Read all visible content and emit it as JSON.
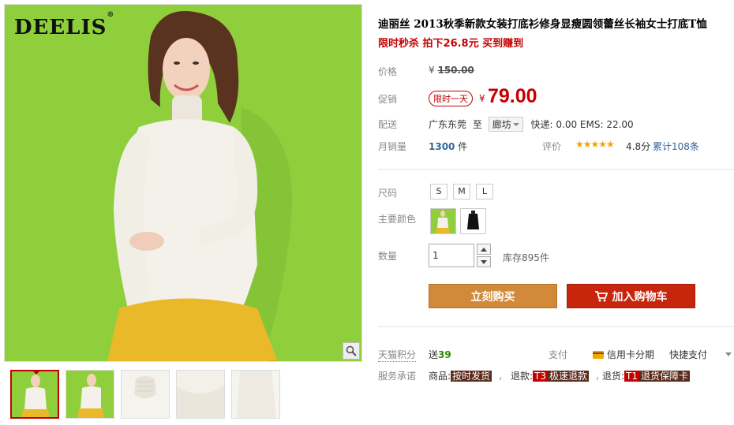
{
  "gallery": {
    "brand": "DEELIS",
    "brand_mark": "®",
    "colors": {
      "background": "#8fcf3c",
      "skirt": "#e9b92a",
      "shirt": "#f4f1ea"
    },
    "thumbnails": [
      {
        "name": "model-front",
        "active": true
      },
      {
        "name": "model-side",
        "active": false
      },
      {
        "name": "collar-detail",
        "active": false
      },
      {
        "name": "fabric-detail",
        "active": false
      },
      {
        "name": "hem-detail",
        "active": false
      }
    ]
  },
  "product": {
    "title": "迪丽丝 2013秋季新款女装打底衫修身显瘦圆领蕾丝长袖女士打底T恤",
    "subtitle": "限时秒杀 拍下26.8元 买到赚到",
    "price_label": "价格",
    "price_currency": "¥",
    "price_original": "150.00",
    "promo_label": "促销",
    "promo_tag": "限时一天",
    "promo_currency": "¥",
    "promo_price": "79.00",
    "shipping_label": "配送",
    "ship_from": "广东东莞",
    "ship_to_word": "至",
    "ship_to_city": "廊坊",
    "shipping_fee": "快递: 0.00 EMS: 22.00",
    "sales_label": "月销量",
    "sales_count": "1300",
    "sales_unit": "件",
    "rating_label": "评价",
    "rating_stars": "★★★★★",
    "rating_score": "4.8分",
    "reviews": "累计108条"
  },
  "options": {
    "size_label": "尺码",
    "sizes": [
      "S",
      "M",
      "L"
    ],
    "color_label": "主要颜色",
    "colors": [
      "white",
      "black"
    ],
    "qty_label": "数量",
    "qty_value": "1",
    "stock": "库存895件"
  },
  "actions": {
    "buy_now": "立刻购买",
    "add_to_cart": "加入购物车"
  },
  "footer": {
    "points_label": "天猫积分",
    "points_prefix": "送",
    "points_value": "39",
    "pay_label": "支付",
    "credit_card": "信用卡分期",
    "quick_pay": "快捷支付",
    "service_label": "服务承诺",
    "svc_goods_prefix": "商品:",
    "svc_goods_tag": "按时发货",
    "svc_refund_prefix": "退款:",
    "svc_refund_code": "T3",
    "svc_refund_tag": "极速退款",
    "svc_return_prefix": "退货:",
    "svc_return_code": "T1",
    "svc_return_tag": "退货保障卡",
    "comma": "，"
  }
}
